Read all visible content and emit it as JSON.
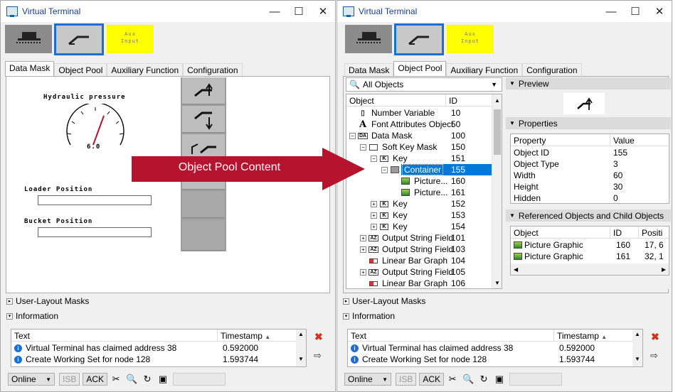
{
  "left": {
    "title": "Virtual Terminal",
    "tabs": [
      "Data Mask",
      "Object Pool",
      "Auxiliary Function",
      "Configuration"
    ],
    "aux_label_1": "Aux",
    "aux_label_2": "Input",
    "gauge_title": "Hydraulic pressure",
    "gauge_value": "6.0",
    "loader_label": "Loader Position",
    "bucket_label": "Bucket Position",
    "user_layout": "User-Layout Masks",
    "information": "Information",
    "info_headers": {
      "text": "Text",
      "timestamp": "Timestamp"
    },
    "info_rows": [
      {
        "text": "Virtual Terminal has claimed address 38",
        "ts": "0.592000"
      },
      {
        "text": "Create Working Set for node 128",
        "ts": "1.593744"
      }
    ],
    "status": {
      "online": "Online",
      "isb": "ISB",
      "ack": "ACK"
    }
  },
  "right": {
    "title": "Virtual Terminal",
    "tabs": [
      "Data Mask",
      "Object Pool",
      "Auxiliary Function",
      "Configuration"
    ],
    "aux_label_1": "Aux",
    "aux_label_2": "Input",
    "filter": "All Objects",
    "tree_headers": {
      "object": "Object",
      "id": "ID"
    },
    "tree": [
      {
        "label": "Number Variable",
        "id": "10",
        "indent": 0,
        "exp": "",
        "icon": "numvar"
      },
      {
        "label": "Font Attributes Object",
        "id": "50",
        "indent": 0,
        "exp": "",
        "icon": "font"
      },
      {
        "label": "Data Mask",
        "id": "100",
        "indent": 0,
        "exp": "−",
        "icon": "da"
      },
      {
        "label": "Soft Key Mask",
        "id": "150",
        "indent": 1,
        "exp": "−",
        "icon": "skm"
      },
      {
        "label": "Key",
        "id": "151",
        "indent": 2,
        "exp": "−",
        "icon": "key"
      },
      {
        "label": "Container",
        "id": "155",
        "indent": 3,
        "exp": "−",
        "icon": "container",
        "selected": true
      },
      {
        "label": "Picture...",
        "id": "160",
        "indent": 4,
        "exp": "",
        "icon": "pic"
      },
      {
        "label": "Picture...",
        "id": "161",
        "indent": 4,
        "exp": "",
        "icon": "pic"
      },
      {
        "label": "Key",
        "id": "152",
        "indent": 2,
        "exp": "+",
        "icon": "key"
      },
      {
        "label": "Key",
        "id": "153",
        "indent": 2,
        "exp": "+",
        "icon": "key"
      },
      {
        "label": "Key",
        "id": "154",
        "indent": 2,
        "exp": "+",
        "icon": "key"
      },
      {
        "label": "Output String Field",
        "id": "101",
        "indent": 1,
        "exp": "+",
        "icon": "osf"
      },
      {
        "label": "Output String Field",
        "id": "103",
        "indent": 1,
        "exp": "+",
        "icon": "osf"
      },
      {
        "label": "Linear Bar Graph",
        "id": "104",
        "indent": 1,
        "exp": "",
        "icon": "lbg"
      },
      {
        "label": "Output String Field",
        "id": "105",
        "indent": 1,
        "exp": "+",
        "icon": "osf"
      },
      {
        "label": "Linear Bar Graph",
        "id": "106",
        "indent": 1,
        "exp": "",
        "icon": "lbg"
      }
    ],
    "preview": "Preview",
    "properties": "Properties",
    "prop_headers": {
      "property": "Property",
      "value": "Value"
    },
    "props": [
      {
        "k": "Object ID",
        "v": "155"
      },
      {
        "k": "Object Type",
        "v": "3"
      },
      {
        "k": "Width",
        "v": "60"
      },
      {
        "k": "Height",
        "v": "30"
      },
      {
        "k": "Hidden",
        "v": "0"
      }
    ],
    "ref_title": "Referenced Objects and Child Objects",
    "ref_headers": {
      "object": "Object",
      "id": "ID",
      "pos": "Positi"
    },
    "refs": [
      {
        "obj": "Picture Graphic",
        "id": "160",
        "pos": "17, 6"
      },
      {
        "obj": "Picture Graphic",
        "id": "161",
        "pos": "32, 1"
      }
    ],
    "user_layout": "User-Layout Masks",
    "information": "Information",
    "info_headers": {
      "text": "Text",
      "timestamp": "Timestamp"
    },
    "info_rows": [
      {
        "text": "Virtual Terminal has claimed address 38",
        "ts": "0.592000"
      },
      {
        "text": "Create Working Set for node 128",
        "ts": "1.593744"
      }
    ],
    "status": {
      "online": "Online",
      "isb": "ISB",
      "ack": "ACK"
    }
  },
  "overlay_label": "Object Pool Content",
  "colors": {
    "arrow": "#b5132e",
    "selection": "#0078d7",
    "active_border": "#1b6fd1"
  }
}
